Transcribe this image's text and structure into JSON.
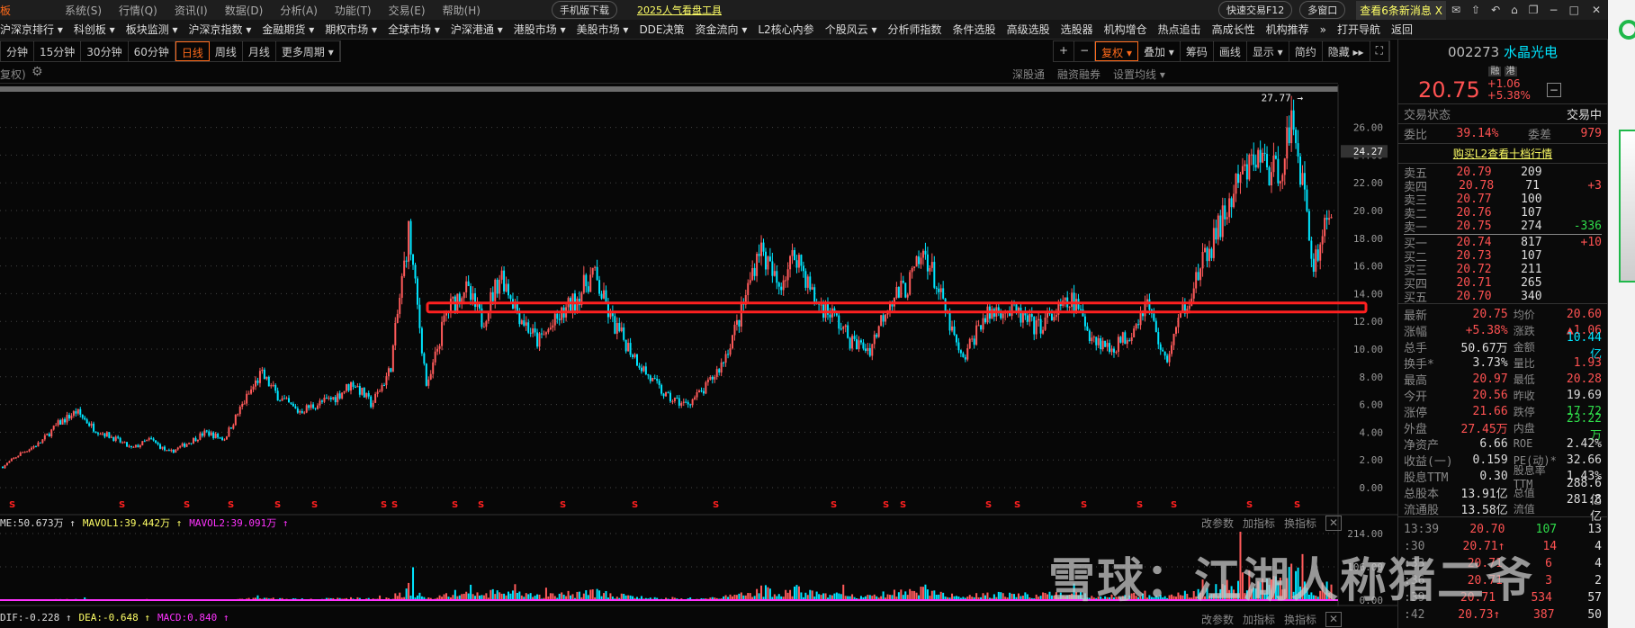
{
  "titlebar": {
    "app_suffix": "板",
    "menus": [
      "系统(S)",
      "行情(Q)",
      "资讯(I)",
      "数据(D)",
      "分析(A)",
      "功能(T)",
      "交易(E)",
      "帮助(H)"
    ],
    "mobile_download": "手机版下载",
    "promo": "2025人气看盘工具",
    "quick_trade": "快速交易F12",
    "multi_window": "多窗口",
    "news": "查看6条新消息 X"
  },
  "nav": [
    "沪深京排行 ▾",
    "科创板 ▾",
    "板块监测 ▾",
    "沪深京指数 ▾",
    "金融期货 ▾",
    "期权市场 ▾",
    "全球市场 ▾",
    "沪深港通 ▾",
    "港股市场 ▾",
    "美股市场 ▾",
    "DDE决策",
    "资金流向 ▾",
    "L2核心内参",
    "个股风云 ▾",
    "分析师指数",
    "条件选股",
    "高级选股",
    "选股器",
    "机构增仓",
    "热点追击",
    "高成长性",
    "机构推荐",
    "»",
    "打开导航",
    "返回"
  ],
  "periods": [
    "分钟",
    "15分钟",
    "30分钟",
    "60分钟",
    "日线",
    "周线",
    "月线",
    "更多周期 ▾"
  ],
  "active_period": "日线",
  "tools": [
    "+",
    "−",
    "复权 ▾",
    "叠加 ▾",
    "筹码",
    "画线",
    "显示 ▾",
    "简约",
    "隐藏 ▸▸",
    "⛶"
  ],
  "chart_header": {
    "left": "复权)",
    "right": [
      "深股通",
      "融资融券",
      "设置均线 ▾"
    ]
  },
  "chart_data": {
    "type": "candlestick",
    "y_ticks": [
      "26.00",
      "24.00",
      "22.00",
      "20.00",
      "18.00",
      "16.00",
      "14.00",
      "12.00",
      "10.00",
      "8.00",
      "6.00",
      "4.00",
      "2.00",
      "0.00"
    ],
    "ylim": [
      0,
      27.77
    ],
    "current_price_tag": "24.27",
    "max_label": "27.77",
    "highlight_level": 13.0,
    "closes": [
      1.5,
      2.5,
      3.2,
      4.6,
      5.5,
      4.2,
      3.6,
      2.8,
      3.5,
      2.5,
      3.2,
      4.0,
      3.5,
      6.0,
      8.2,
      6.5,
      5.5,
      6.0,
      6.5,
      7.6,
      6.0,
      8.5,
      18.5,
      7.0,
      12.5,
      14.5,
      12.0,
      15.5,
      12.5,
      10.5,
      12.0,
      13.5,
      15.5,
      12.0,
      10.0,
      8.0,
      6.5,
      6.0,
      7.0,
      9.0,
      12.5,
      17.5,
      14.5,
      17.0,
      13.5,
      12.5,
      10.5,
      10.0,
      13.5,
      14.5,
      17.0,
      13.0,
      9.0,
      12.0,
      13.0,
      12.5,
      11.5,
      12.5,
      13.5,
      11.0,
      10.0,
      11.0,
      13.5,
      9.0,
      13.0,
      16.0,
      19.0,
      22.0,
      24.0,
      22.5,
      26.5,
      16.0,
      20.5
    ]
  },
  "volume": {
    "label": "ME:50.673万 ↑",
    "mavol1": "MAVOL1:39.442万 ↑",
    "mavol2": "MAVOL2:39.091万 ↑",
    "axis": [
      "214.00",
      "106.00",
      "0.00"
    ],
    "actions": [
      "改参数",
      "加指标",
      "换指标"
    ]
  },
  "macd": {
    "dif": "DIF:-0.228 ↑",
    "dea": "DEA:-0.648 ↑",
    "macd": "MACD:0.840 ↑",
    "actions": [
      "改参数",
      "加指标",
      "换指标"
    ]
  },
  "stock": {
    "code": "002273",
    "name": "水晶光电",
    "tags": [
      "融",
      "港"
    ],
    "price": "20.75",
    "change": "+1.06",
    "pct": "+5.38%",
    "status_label": "交易状态",
    "status": "交易中",
    "wb_label": "委比",
    "wb": "39.14%",
    "wc_label": "委差",
    "wc": "979",
    "l2_link": "购买L2查看十档行情",
    "asks": [
      [
        "卖五",
        "20.79",
        "209",
        ""
      ],
      [
        "卖四",
        "20.78",
        "71",
        "+3"
      ],
      [
        "卖三",
        "20.77",
        "100",
        ""
      ],
      [
        "卖二",
        "20.76",
        "107",
        ""
      ],
      [
        "卖一",
        "20.75",
        "274",
        "-336"
      ]
    ],
    "bids": [
      [
        "买一",
        "20.74",
        "817",
        "+10"
      ],
      [
        "买二",
        "20.73",
        "107",
        ""
      ],
      [
        "买三",
        "20.72",
        "211",
        ""
      ],
      [
        "买四",
        "20.71",
        "265",
        ""
      ],
      [
        "买五",
        "20.70",
        "340",
        ""
      ]
    ],
    "stats": [
      [
        "最新",
        "20.75",
        "均价",
        "20.60"
      ],
      [
        "涨幅",
        "+5.38%",
        "涨跌",
        "▲1.06"
      ],
      [
        "总手",
        "50.67万",
        "金额",
        "10.44亿"
      ],
      [
        "换手*",
        "3.73%",
        "量比",
        "1.93"
      ],
      [
        "最高",
        "20.97",
        "最低",
        "20.28"
      ],
      [
        "今开",
        "20.56",
        "昨收",
        "19.69"
      ],
      [
        "涨停",
        "21.66",
        "跌停",
        "17.72"
      ],
      [
        "外盘",
        "27.45万",
        "内盘",
        "23.22万"
      ],
      [
        "净资产",
        "6.66",
        "ROE",
        "2.42%"
      ],
      [
        "收益(一)",
        "0.159",
        "PE(动)*",
        "32.66"
      ],
      [
        "股息TTM",
        "0.30",
        "股息率TTM",
        "1.43%"
      ],
      [
        "总股本",
        "13.91亿",
        "总值",
        "288.6亿"
      ],
      [
        "流通股",
        "13.58亿",
        "流值",
        "281.8亿"
      ]
    ],
    "ticks": [
      [
        "13:39",
        "20.70",
        "107",
        "13"
      ],
      [
        ":30",
        "20.71↑",
        "14",
        "4"
      ],
      [
        ":33",
        "20.71",
        "6",
        "4"
      ],
      [
        ":36",
        "20.71",
        "3",
        "2"
      ],
      [
        ":39",
        "20.71",
        "534",
        "57"
      ],
      [
        ":42",
        "20.73↑",
        "387",
        "50"
      ]
    ]
  },
  "watermark": "雪球：江湖人称猪二爷",
  "colors": {
    "up": "#ff5a5a",
    "down": "#00e5ff",
    "accent": "#ff6a1a",
    "highlight_box": "#ff2020"
  }
}
